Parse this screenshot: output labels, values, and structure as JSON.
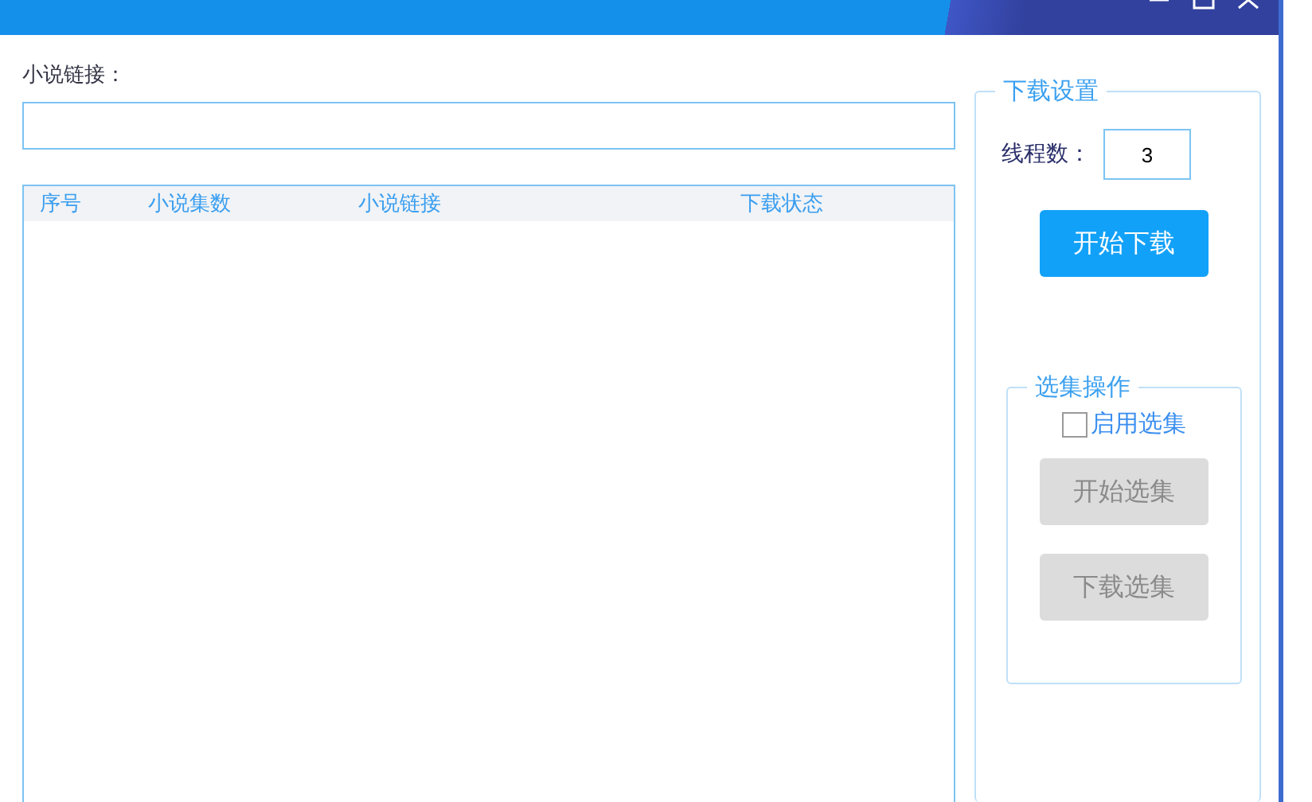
{
  "url_label": "小说链接：",
  "table": {
    "columns": [
      "序号",
      "小说集数",
      "小说链接",
      "下载状态"
    ]
  },
  "settings": {
    "title": "下载设置",
    "thread_label": "线程数：",
    "thread_value": "3",
    "start_button": {
      "label": "开始下载",
      "disabled": false
    }
  },
  "selection": {
    "title": "选集操作",
    "checkbox": {
      "label": "启用选集",
      "checked": false
    },
    "buttons": [
      {
        "label": "开始选集",
        "disabled": true
      },
      {
        "label": "下载选集",
        "disabled": true
      }
    ]
  }
}
